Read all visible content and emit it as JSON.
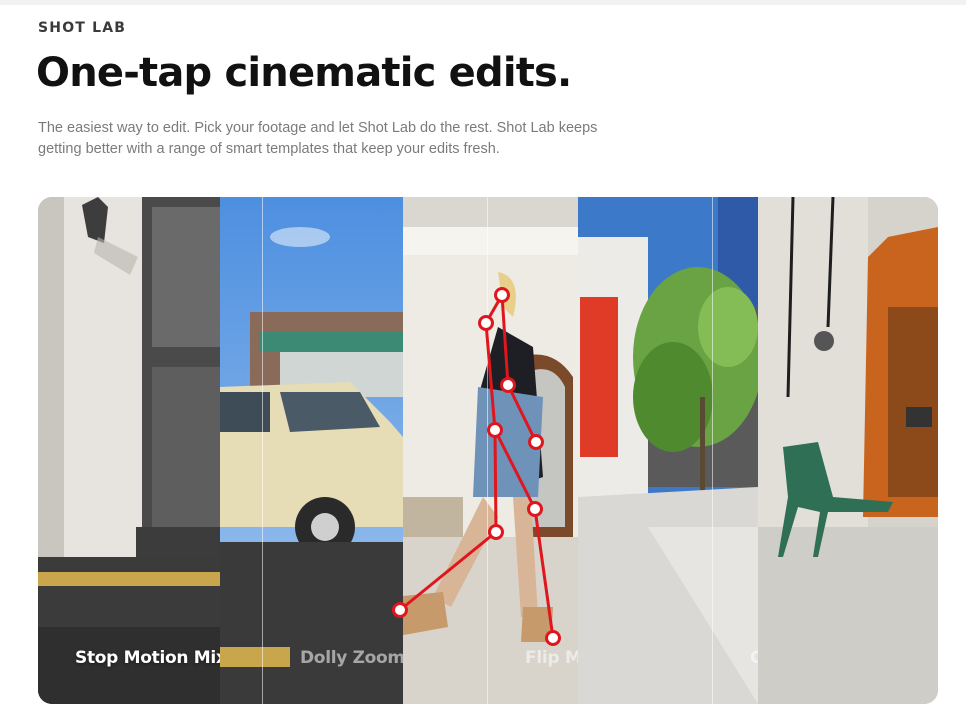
{
  "header": {
    "eyebrow": "SHOT LAB",
    "title": "One-tap cinematic edits.",
    "description": "The easiest way to edit. Pick your footage and let Shot Lab do the rest. Shot Lab keeps getting better with a range of smart templates that keep your edits fresh."
  },
  "templates": [
    {
      "label": "Stop Motion Mix",
      "active": true
    },
    {
      "label": "Dolly Zoom",
      "active": false
    },
    {
      "label": "Flip My Day",
      "active": false
    },
    {
      "label": "Clone Trail",
      "active": false
    }
  ],
  "colors": {
    "headline": "#111111",
    "description": "#7b7b7b",
    "skeleton": "#e0161e",
    "joint_fill": "#ffffff"
  }
}
